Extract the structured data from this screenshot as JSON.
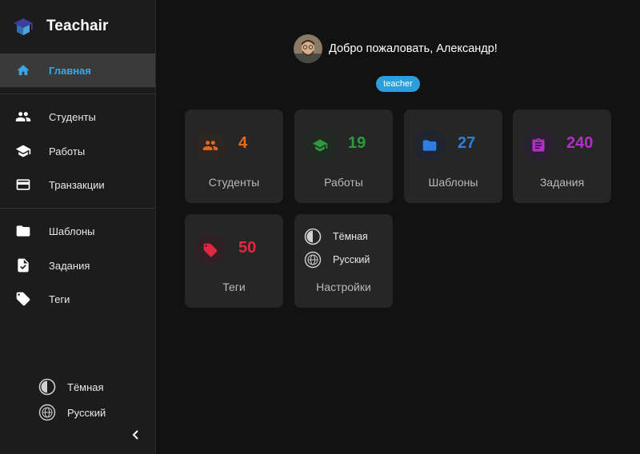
{
  "app": {
    "title": "Teachair"
  },
  "sidebar": {
    "items": [
      {
        "label": "Главная",
        "icon": "home-icon",
        "active": true
      },
      {
        "label": "Студенты",
        "icon": "people-icon"
      },
      {
        "label": "Работы",
        "icon": "school-icon"
      },
      {
        "label": "Транзакции",
        "icon": "credit-card-icon"
      },
      {
        "label": "Шаблоны",
        "icon": "folder-icon"
      },
      {
        "label": "Задания",
        "icon": "assignment-icon"
      },
      {
        "label": "Теги",
        "icon": "tag-icon"
      }
    ],
    "theme_label": "Тёмная",
    "language_label": "Русский"
  },
  "header": {
    "welcome": "Добро пожаловать, Александр!",
    "role": "teacher"
  },
  "cards": [
    {
      "label": "Студенты",
      "count": "4",
      "icon": "people-icon",
      "color": "#e8661e"
    },
    {
      "label": "Работы",
      "count": "19",
      "icon": "school-icon",
      "color": "#2e9a3e"
    },
    {
      "label": "Шаблоны",
      "count": "27",
      "icon": "folder-icon",
      "color": "#2f7de0"
    },
    {
      "label": "Задания",
      "count": "240",
      "icon": "assignment-icon",
      "color": "#b22fc8"
    },
    {
      "label": "Теги",
      "count": "50",
      "icon": "tag-icon",
      "color": "#e0283e"
    }
  ],
  "settings_card": {
    "label": "Настройки",
    "theme_label": "Тёмная",
    "language_label": "Русский"
  },
  "colors": {
    "accent": "#3aa8e6",
    "badge": "#2b9fdc",
    "sidebar_bg": "#1c1c1c",
    "page_bg": "#121212",
    "card_bg": "#262626"
  }
}
